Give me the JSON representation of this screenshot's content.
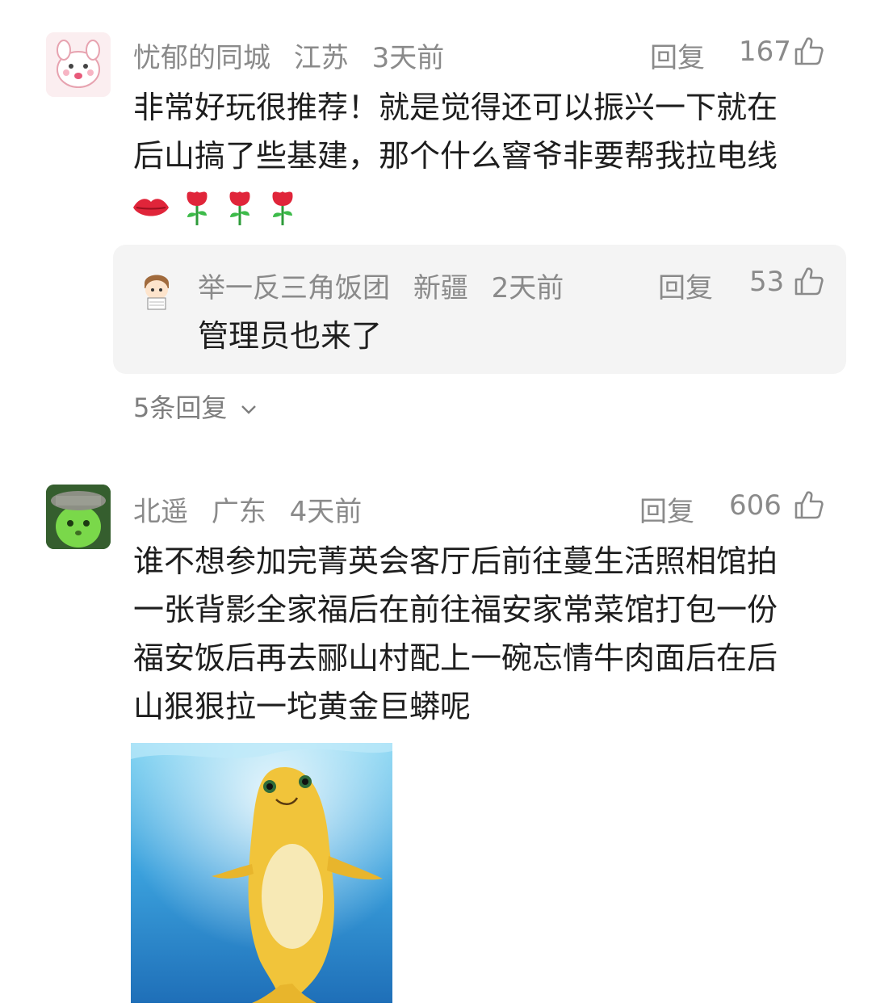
{
  "comments": [
    {
      "username": "忧郁的同城",
      "location": "江苏",
      "time": "3天前",
      "reply_label": "回复",
      "likes": "167",
      "text_lines": [
        "非常好玩很推荐！就是觉得还可以振兴一下就在",
        "后山搞了些基建，那个什么窨爷非要帮我拉电线"
      ],
      "emojis": [
        "lips-emoji",
        "rose-emoji",
        "rose-emoji",
        "rose-emoji"
      ],
      "sub_reply": {
        "username": "举一反三角饭团",
        "location": "新疆",
        "time": "2天前",
        "reply_label": "回复",
        "likes": "53",
        "text": "管理员也来了"
      },
      "more_replies": "5条回复"
    },
    {
      "username": "北遥",
      "location": "广东",
      "time": "4天前",
      "reply_label": "回复",
      "likes": "606",
      "text_lines": [
        "谁不想参加完菁英会客厅后前往蔓生活照相馆拍",
        "一张背影全家福后在前往福安家常菜馆打包一份",
        "福安饭后再去郦山村配上一碗忘情牛肉面后在后",
        "山狠狠拉一坨黄金巨蟒呢"
      ],
      "image": "yellow-dolphin-sticker"
    }
  ]
}
